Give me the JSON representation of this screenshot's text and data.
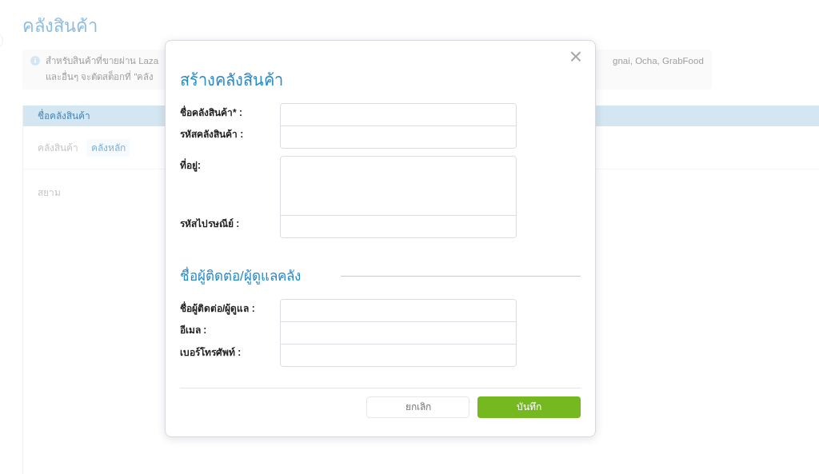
{
  "page": {
    "title": "คลังสินค้า",
    "info_lines": [
      "สำหรับสินค้าที่ขายผ่าน Laza",
      "และอื่นๆ จะตัดสต็อกที่ \"คลัง"
    ],
    "info_tail": "gnai, Ocha, GrabFood",
    "table_header": "ชื่อคลังสินค้า",
    "row_label": "คลังสินค้า",
    "row_badge": "คลังหลัก",
    "row_2": "สยาม"
  },
  "dialog": {
    "close": "×",
    "title": "สร้างคลังสินค้า",
    "groups": [
      {
        "fields": [
          {
            "label": "ชื่อคลังสินค้า* :",
            "kind": "input"
          },
          {
            "label": "รหัสคลังสินค้า :",
            "kind": "input"
          }
        ]
      },
      {
        "fields": [
          {
            "label": "ที่อยู่:",
            "kind": "textarea"
          },
          {
            "label": "รหัสไปรษณีย์ :",
            "kind": "input"
          }
        ]
      }
    ],
    "section_title": "ชื่อผู้ติดต่อ/ผู้ดูแลคลัง",
    "contact_fields": [
      {
        "label": "ชื่อผู้ติดต่อ/ผู้ดูแล :"
      },
      {
        "label": "อีเมล :"
      },
      {
        "label": "เบอร์โทรศัพท์ :"
      }
    ],
    "cancel": "ยกเลิก",
    "save": "บันทึก"
  }
}
